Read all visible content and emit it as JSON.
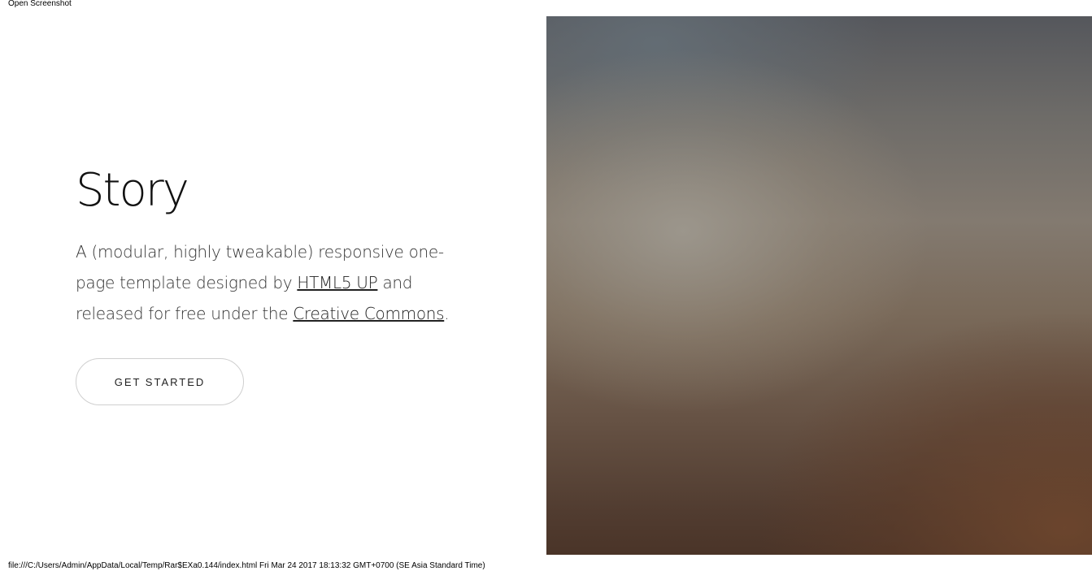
{
  "header": {
    "open_screenshot": "Open Screenshot"
  },
  "hero": {
    "title": "Story",
    "desc_part1": "A (modular, highly tweakable) responsive one-page template designed by ",
    "link_html5up": "HTML5 UP",
    "desc_part2": " and released for free under the ",
    "link_cc": "Creative Commons",
    "desc_part3": ".",
    "cta_label": "GET STARTED"
  },
  "footer": {
    "status": "file:///C:/Users/Admin/AppData/Local/Temp/Rar$EXa0.144/index.html Fri Mar 24 2017 18:13:32 GMT+0700 (SE Asia Standard Time)"
  }
}
